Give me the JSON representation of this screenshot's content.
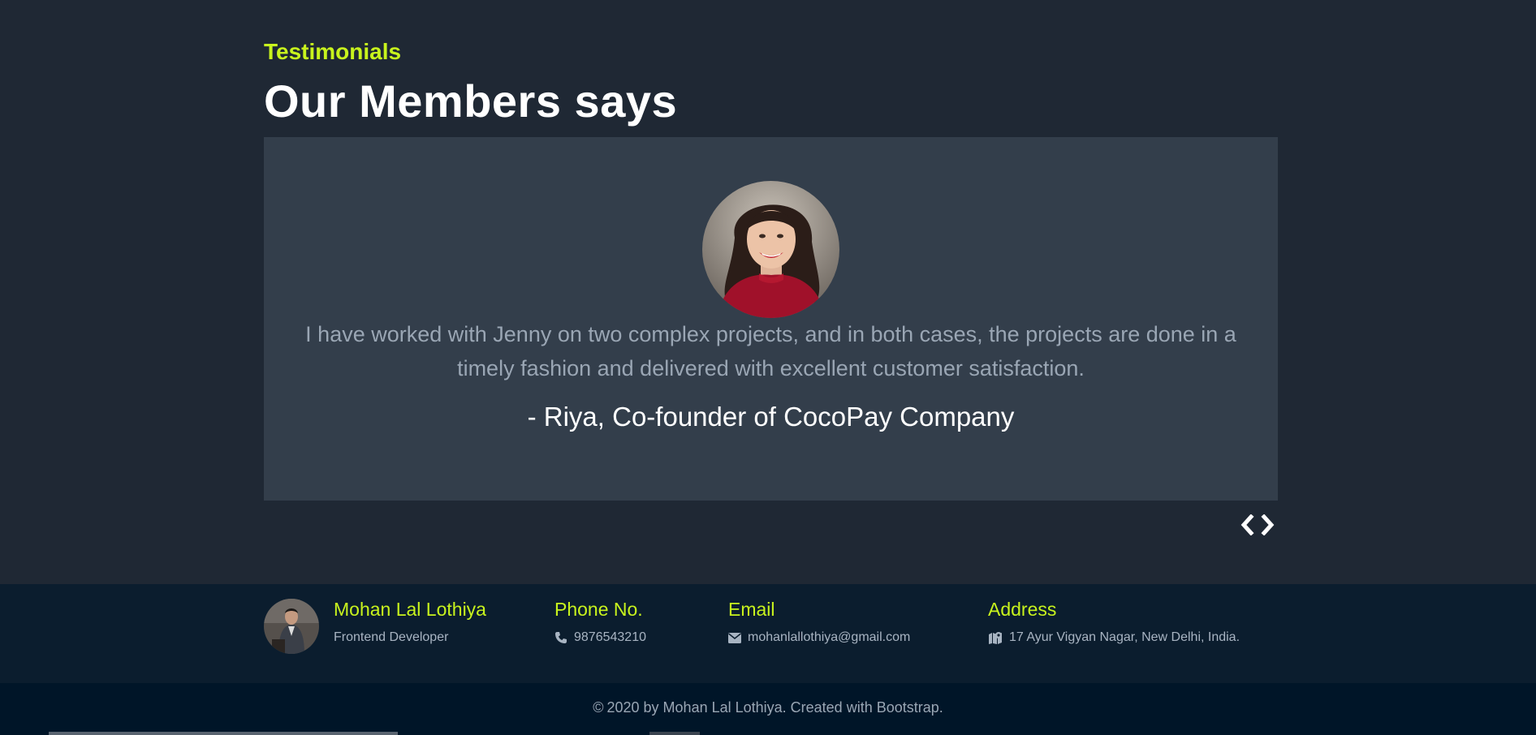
{
  "section": {
    "kicker": "Testimonials",
    "heading": "Our Members says"
  },
  "testimonial": {
    "avatar": "woman-portrait-avatar",
    "quote": "I have worked with Jenny on two complex projects, and in both cases, the projects are done in a timely fashion and delivered with excellent customer satisfaction.",
    "author": "- Riya, Co-founder of CocoPay Company"
  },
  "carousel": {
    "prev_icon": "chevron-left-icon",
    "next_icon": "chevron-right-icon"
  },
  "footer": {
    "profile": {
      "name": "Mohan Lal Lothiya",
      "role": "Frontend Developer"
    },
    "phone": {
      "title": "Phone No.",
      "value": "9876543210",
      "icon": "phone-icon"
    },
    "email": {
      "title": "Email",
      "value": "mohanlallothiya@gmail.com",
      "icon": "envelope-icon"
    },
    "address": {
      "title": "Address",
      "value": "17 Ayur Vigyan Nagar, New Delhi, India.",
      "icon": "map-icon"
    }
  },
  "copyright": {
    "symbol": "©",
    "text": "2020 by Mohan Lal Lothiya. Created with Bootstrap."
  },
  "colors": {
    "accent": "#c8f31d",
    "page_bg": "#1f2834",
    "card_bg": "#333e4b",
    "footer_bg": "#0b1d2e",
    "copyright_bg": "#001528"
  }
}
